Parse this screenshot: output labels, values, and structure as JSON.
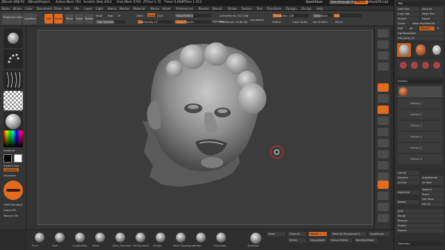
{
  "titlebar": {
    "app": "ZBrush 4R8 P2",
    "project": "ZBrushProject",
    "active_mem": "Active Mem 764",
    "scratch_disk": "Scratch Disk 4412",
    "free_mem": "Free Mem 5791",
    "ztime": "ZTime 1.72",
    "timer": "Timer 0.062",
    "atime": "ATime 1.012",
    "quicksave": "QuickSave",
    "see_through": "See-through 0",
    "menus": "Menus",
    "default_zscript": "DefaultZScript"
  },
  "menubar": {
    "items": [
      "Alpha",
      "Brush",
      "Color",
      "Document",
      "Draw",
      "Edit",
      "File",
      "Layer",
      "Light",
      "Macro",
      "Marker",
      "Material",
      "Movie",
      "Picker",
      "Preferences",
      "Render",
      "Stencil",
      "Stroke",
      "Texture",
      "Tool",
      "Transform",
      "Zplugin",
      "Zscript",
      "Help"
    ]
  },
  "topshelf": {
    "projection_master": "Projection Master",
    "lightbox": "LightBox",
    "edit": "Edit",
    "draw": "Draw",
    "move": "Move",
    "scale": "Scale",
    "rotate": "Rotate",
    "mrgb": "Mrgb",
    "rgb": "Rgb",
    "m": "M",
    "rgb_intensity": "Rgb Intensity",
    "zadd": "Zadd",
    "zsub": "Zsub",
    "zcut": "Zcut",
    "z_intensity": "Z Intensity 14",
    "focal_shift": "Focal Shift 0",
    "draw_size": "Draw Size 67",
    "dynamic": "Dynamic",
    "active_points": "ActivePoints: 812,286",
    "total_points": "TotalPoints: 14.84 Mil",
    "resolution": "Resolution 128",
    "neighbors": "Neighbors",
    "refine": "Refine",
    "close_holes": "Close Holes",
    "dynamesh": "DynaMesh",
    "del_hidden": "Del Hidden",
    "mirror": "Mirror",
    "blur": "Blur"
  },
  "leftshelf": {
    "gradient": "Gradient",
    "switch_color": "SwitchColor",
    "alternate": "Alternate",
    "duplicate": "Duplicate",
    "vdm": "VDM Standard",
    "alpha_off": "Alpha Off",
    "texture_off": "Texture Off"
  },
  "tray": {
    "title": "Tool",
    "load_tool": "Load Tool",
    "save_as": "Save As",
    "copy_tool": "Copy Tool",
    "paste_tool": "Paste Tool",
    "import": "Import",
    "export": "Export",
    "clone": "Clone",
    "make_polymesh": "Make PolyMesh3D",
    "goz": "GoZ",
    "all": "All",
    "visible": "Visible",
    "r": "R",
    "lightbox_tools": "Lightbox▸Tools",
    "tool_name": "tree_body_51",
    "subtool": "SubTool",
    "list_all": "List All",
    "rename": "Rename",
    "auto_reorder": "AutoReorder",
    "all_low": "All Low",
    "all_high": "All High",
    "duplicate": "Duplicate",
    "append": "Append",
    "insert": "Insert",
    "delete": "Delete",
    "del_other": "Del Other",
    "del_all": "Del All",
    "split": "Split",
    "merge": "Merge",
    "remesh": "Remesh",
    "project": "Project",
    "extract": "Extract",
    "geometry": "Geometry",
    "subtools": [
      "Subtool_1",
      "Subtool_2",
      "Subtool_3",
      "Subtool_4",
      "Subtool_5",
      "Subtool_6"
    ]
  },
  "bottomshelf": {
    "brushes": [
      "Pinch",
      "Dam",
      "ClayBuildup",
      "Move",
      "Dam_Standard",
      "TrimDynamic",
      "hPolish",
      "Move Topological",
      "Inflate",
      "ClayTubes"
    ],
    "standard": "Standard",
    "draw": "Draw",
    "grow_all": "Grow All",
    "double": "Double",
    "shrink": "Shrink",
    "groups_split": "GroupsSplit",
    "group_visible": "Group Visible",
    "mask_by_polygroups": "Mask By Polygroups 0",
    "backface_mask": "BackfaceMask",
    "lazy_mouse": "LazyMouse"
  },
  "accent": "#e36b1e"
}
